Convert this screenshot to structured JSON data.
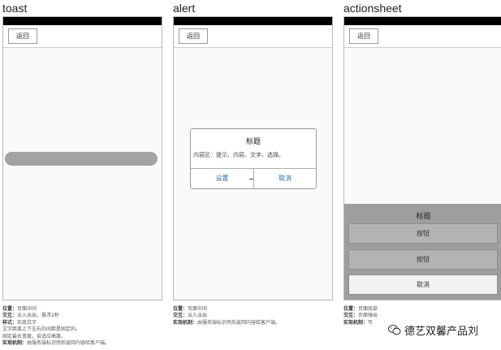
{
  "panels": [
    {
      "title": "toast",
      "back": "返回"
    },
    {
      "title": "alert",
      "back": "返回"
    },
    {
      "title": "actionsheet",
      "back": "返回"
    }
  ],
  "alert": {
    "title": "标题",
    "content": "内容区：提示、内容、文字、选择。",
    "btn_left": "设置",
    "btn_right": "取消"
  },
  "actionsheet": {
    "title": "标题",
    "btn1": "按钮",
    "btn2": "按钮",
    "cancel": "取消"
  },
  "notes": {
    "toast": [
      {
        "key": "位置：",
        "val": "页面中间"
      },
      {
        "key": "交互：",
        "val": "淡入淡出，悬浮2秒"
      },
      {
        "key": "样式：",
        "val": "灰底白字"
      },
      {
        "key": "",
        "val": "文字距离上下左右的间距是固定的。"
      },
      {
        "key": "",
        "val": "固定最长宽度，自适应高度。"
      },
      {
        "key": "实现机制：",
        "val": "由服务端标识然后返回内容给客户端。"
      }
    ],
    "alert": [
      {
        "key": "位置：",
        "val": "页面中间"
      },
      {
        "key": "交互：",
        "val": "淡入淡出"
      },
      {
        "key": "实现机制：",
        "val": "由服务端标识然后返回内容给客户端。"
      }
    ],
    "actionsheet": [
      {
        "key": "位置：",
        "val": "页面底部"
      },
      {
        "key": "交互：",
        "val": "页面弹出"
      },
      {
        "key": "实现机制：",
        "val": "写"
      }
    ]
  },
  "watermark": {
    "text": "德艺双馨产品刘",
    "icon": "wechat-icon"
  }
}
